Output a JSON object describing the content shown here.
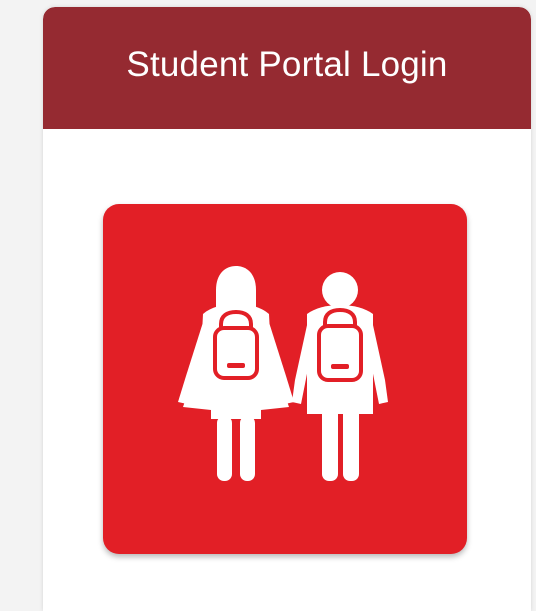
{
  "login_card": {
    "title": "Student Portal Login"
  },
  "portal_tile": {
    "icon": "students-with-backpacks-icon"
  },
  "colors": {
    "header_background": "#952a31",
    "tile_background": "#e21f26",
    "icon_foreground": "#ffffff"
  }
}
